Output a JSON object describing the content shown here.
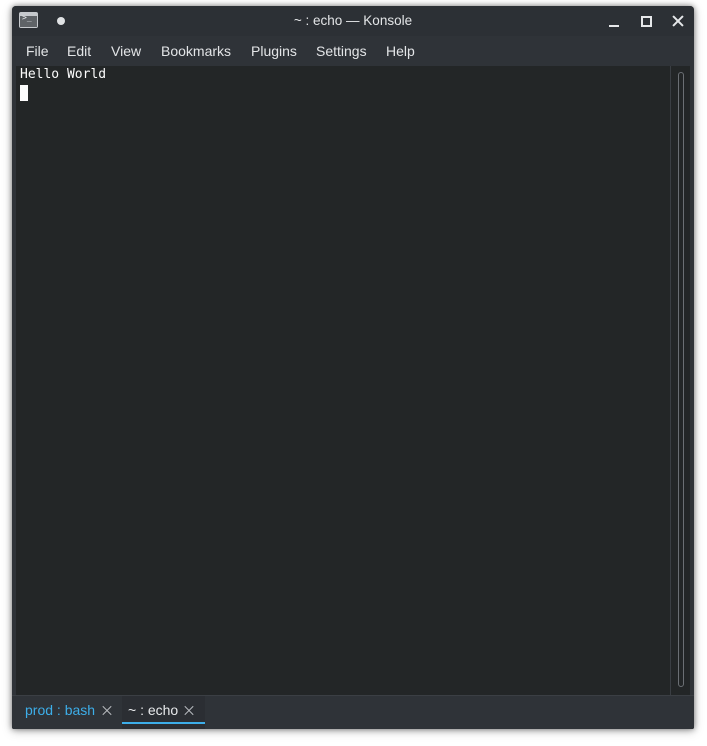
{
  "window": {
    "title": "~ : echo — Konsole",
    "app_icon": "terminal-prompt-icon",
    "app_icon_glyph": ">_",
    "controls": [
      "minimize-icon",
      "maximize-icon",
      "close-icon"
    ]
  },
  "menubar": {
    "items": [
      "File",
      "Edit",
      "View",
      "Bookmarks",
      "Plugins",
      "Settings",
      "Help"
    ]
  },
  "terminal": {
    "output": "Hello World",
    "background": "#232627",
    "foreground": "#fcfcfc"
  },
  "tabs": [
    {
      "label": "prod : bash",
      "active": false
    },
    {
      "label": "~ : echo",
      "active": true
    }
  ],
  "colors": {
    "accent": "#3daee9",
    "chrome": "#2f3338"
  }
}
